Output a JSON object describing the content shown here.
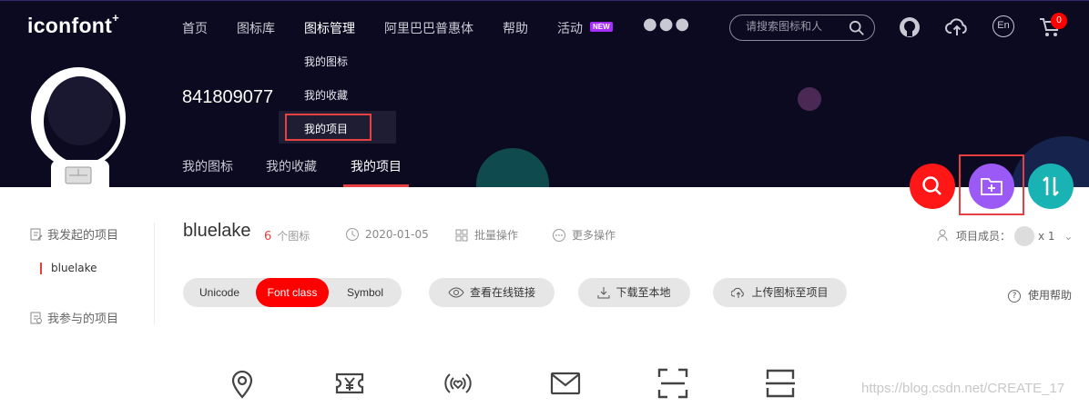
{
  "header": {
    "logo": "iconfont",
    "logo_mark": "+",
    "nav": [
      "首页",
      "图标库",
      "图标管理",
      "阿里巴巴普惠体",
      "帮助",
      "活动"
    ],
    "activity_badge": "NEW",
    "search_placeholder": "请搜索图标和人",
    "cart_count": "0",
    "lang": "En",
    "icons": [
      "github-icon",
      "upload-cloud-icon",
      "language-icon",
      "cart-icon",
      "more-icon"
    ]
  },
  "dropdown": {
    "items": [
      "我的图标",
      "我的收藏",
      "我的项目"
    ],
    "active": "我的项目"
  },
  "profile": {
    "username": "841809077",
    "tabs": [
      "我的图标",
      "我的收藏",
      "我的项目"
    ],
    "active_tab": "我的项目"
  },
  "sidebar": {
    "created_label": "我发起的项目",
    "project": "bluelake",
    "joined_label": "我参与的项目"
  },
  "project": {
    "name": "bluelake",
    "icon_count": "6",
    "icon_count_suffix": "个图标",
    "date": "2020-01-05",
    "batch": "批量操作",
    "more": "更多操作",
    "members_label": "项目成员：",
    "members_count": "x 1"
  },
  "toolbar": {
    "tabs": [
      "Unicode",
      "Font class",
      "Symbol"
    ],
    "active_tab": "Font class",
    "view_link": "查看在线链接",
    "download": "下载至本地",
    "upload": "上传图标至项目",
    "help": "使用帮助",
    "help_mark": "?"
  },
  "icons": [
    "location-icon",
    "ticket-yen-icon",
    "broadcast-heart-icon",
    "mail-icon",
    "scan-icon",
    "scan-line-icon"
  ],
  "watermark": "https://blog.csdn.net/CREATE_17",
  "colors": {
    "header_bg": "#0b0a20",
    "accent_red": "#ff0000",
    "fab_purple": "#9b5af5",
    "fab_teal": "#1ab3b3",
    "new_badge": "#a62cff"
  }
}
